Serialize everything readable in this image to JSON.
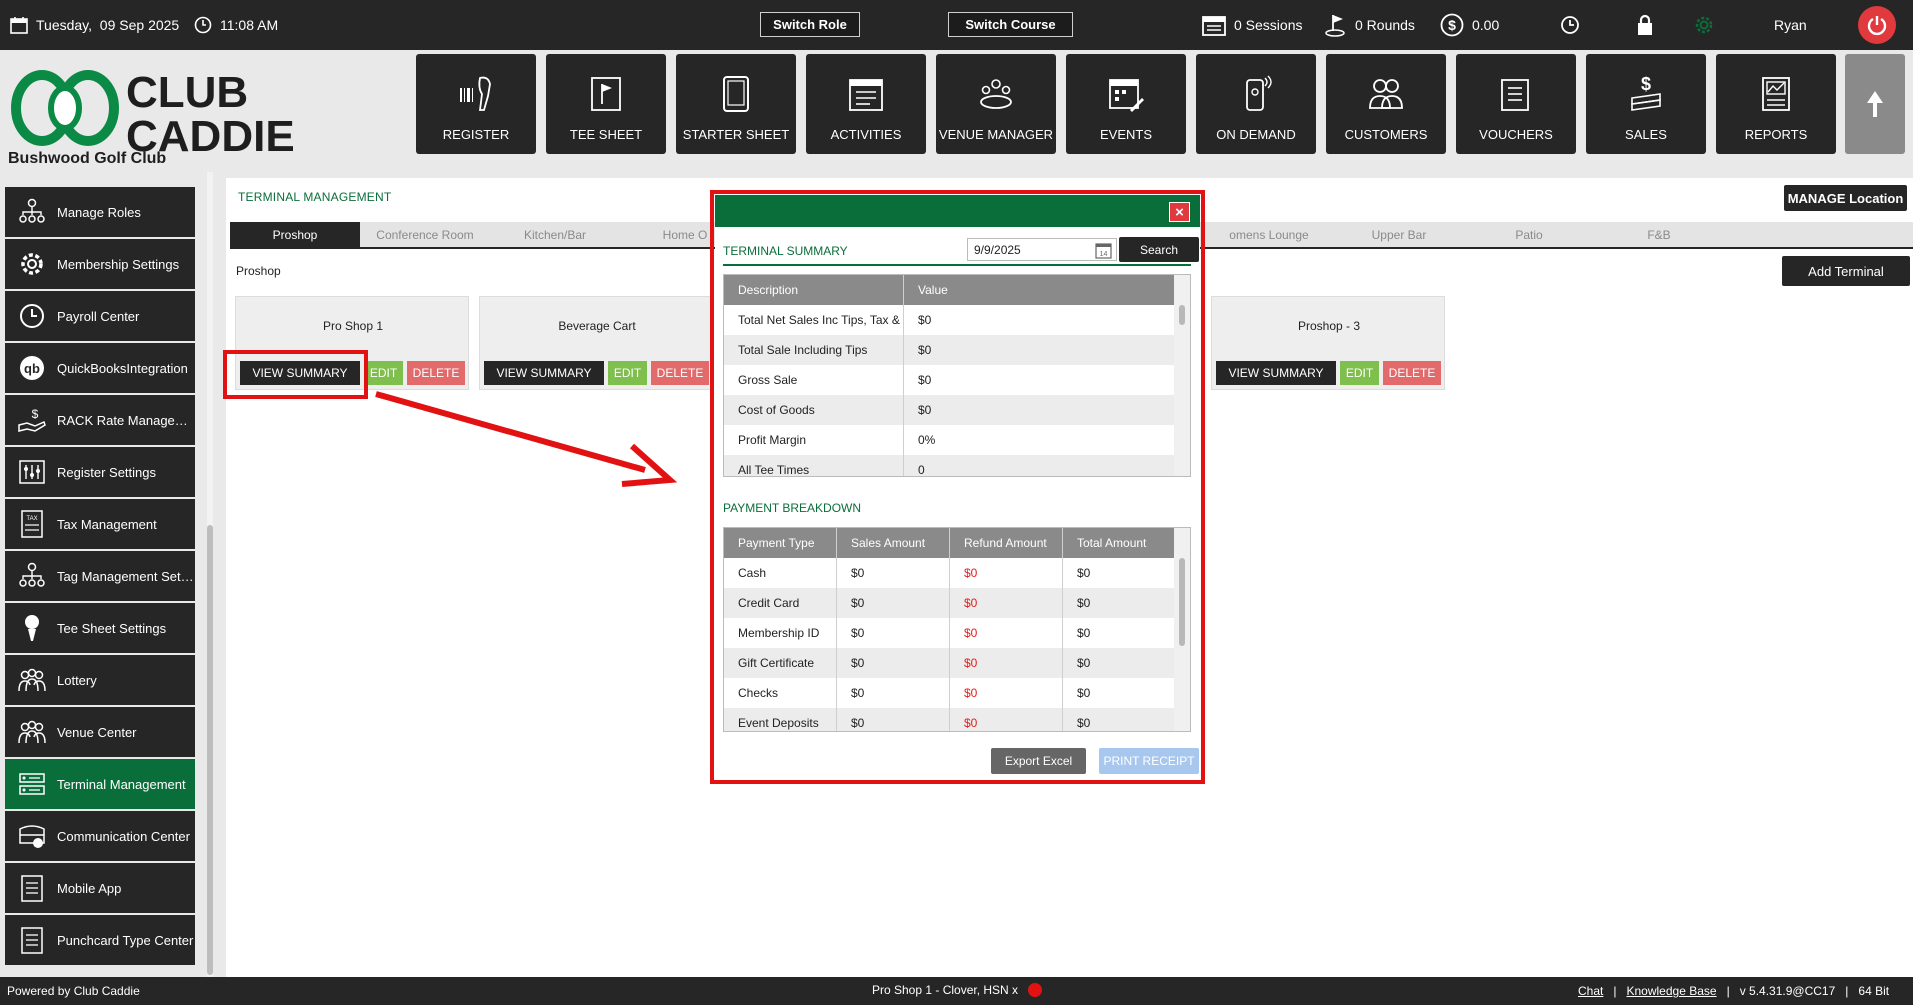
{
  "topbar": {
    "date": "Tuesday,  09 Sep 2025",
    "time": "11:08 AM",
    "switch_role": "Switch Role",
    "switch_course": "Switch Course",
    "sessions": "0 Sessions",
    "rounds": "0 Rounds",
    "balance": "0.00",
    "user": "Ryan"
  },
  "header": {
    "logo_text_1": "CLUB",
    "logo_text_2": "CADDIE",
    "club_name": "Bushwood Golf Club",
    "nav": [
      {
        "label": "REGISTER",
        "icon": "barcode-scanner-icon"
      },
      {
        "label": "TEE SHEET",
        "icon": "flag-icon"
      },
      {
        "label": "STARTER SHEET",
        "icon": "tablet-icon"
      },
      {
        "label": "ACTIVITIES",
        "icon": "calendar-list-icon"
      },
      {
        "label": "VENUE MANAGER",
        "icon": "meeting-table-icon"
      },
      {
        "label": "EVENTS",
        "icon": "calendar-edit-icon"
      },
      {
        "label": "ON DEMAND",
        "icon": "mobile-signal-icon"
      },
      {
        "label": "CUSTOMERS",
        "icon": "people-icon"
      },
      {
        "label": "VOUCHERS",
        "icon": "voucher-icon"
      },
      {
        "label": "SALES",
        "icon": "money-stack-icon"
      },
      {
        "label": "REPORTS",
        "icon": "report-chart-icon"
      }
    ]
  },
  "sidebar": {
    "items": [
      {
        "label": "Manage Roles"
      },
      {
        "label": "Membership Settings"
      },
      {
        "label": "Payroll Center"
      },
      {
        "label": "QuickBooksIntegration"
      },
      {
        "label": "RACK Rate Manageme..."
      },
      {
        "label": "Register Settings"
      },
      {
        "label": "Tax Management"
      },
      {
        "label": "Tag Management Setti..."
      },
      {
        "label": "Tee Sheet Settings"
      },
      {
        "label": "Lottery"
      },
      {
        "label": "Venue Center"
      },
      {
        "label": "Terminal Management"
      },
      {
        "label": "Communication Center"
      },
      {
        "label": "Mobile App"
      },
      {
        "label": "Punchcard Type Center"
      }
    ]
  },
  "main": {
    "title": "TERMINAL MANAGEMENT",
    "manage_location": "MANAGE Location",
    "tabs": [
      {
        "label": "Proshop"
      },
      {
        "label": "Conference Room"
      },
      {
        "label": "Kitchen/Bar"
      },
      {
        "label": "Home O"
      },
      {
        "label": "omens Lounge"
      },
      {
        "label": "Upper Bar"
      },
      {
        "label": "Patio"
      },
      {
        "label": "F&B"
      }
    ],
    "section": "Proshop",
    "add_terminal": "Add Terminal",
    "cards": [
      {
        "name": "Pro Shop 1",
        "view": "VIEW SUMMARY",
        "edit": "EDIT",
        "delete": "DELETE"
      },
      {
        "name": "Beverage Cart",
        "view": "VIEW SUMMARY",
        "edit": "EDIT",
        "delete": "DELETE"
      },
      {
        "name": "Proshop - 3",
        "view": "VIEW SUMMARY",
        "edit": "EDIT",
        "delete": "DELETE"
      }
    ]
  },
  "modal": {
    "title": "TERMINAL SUMMARY",
    "close": "×",
    "date": "9/9/2025",
    "date_icon_day": "14",
    "search": "Search",
    "summary_headers": [
      "Description",
      "Value"
    ],
    "summary_rows": [
      [
        "Total Net Sales Inc Tips, Tax &",
        "$0"
      ],
      [
        "Total Sale Including Tips",
        "$0"
      ],
      [
        "Gross Sale",
        "$0"
      ],
      [
        "Cost of Goods",
        "$0"
      ],
      [
        "Profit Margin",
        "0%"
      ],
      [
        "All Tee Times",
        "0"
      ]
    ],
    "payment_title": "PAYMENT BREAKDOWN",
    "payment_headers": [
      "Payment Type",
      "Sales Amount",
      "Refund Amount",
      "Total Amount"
    ],
    "payment_rows": [
      [
        "Cash",
        "$0",
        "$0",
        "$0"
      ],
      [
        "Credit Card",
        "$0",
        "$0",
        "$0"
      ],
      [
        "Membership ID",
        "$0",
        "$0",
        "$0"
      ],
      [
        "Gift Certificate",
        "$0",
        "$0",
        "$0"
      ],
      [
        "Checks",
        "$0",
        "$0",
        "$0"
      ],
      [
        "Event Deposits",
        "$0",
        "$0",
        "$0"
      ]
    ],
    "export": "Export Excel",
    "print": "PRINT RECEIPT"
  },
  "footer": {
    "powered": "Powered by Club Caddie",
    "terminal": "Pro Shop 1 - Clover, HSN x",
    "chat": "Chat",
    "sep1": "|",
    "kb": "Knowledge Base",
    "sep2": "|",
    "version": "v 5.4.31.9@CC17",
    "sep3": "|",
    "bits": "64 Bit"
  },
  "colors": {
    "brand_green": "#0a6e3a",
    "dark": "#262626",
    "edit_green": "#7fbf4d",
    "delete_red": "#e26a6a",
    "annotation_red": "#e31212"
  }
}
